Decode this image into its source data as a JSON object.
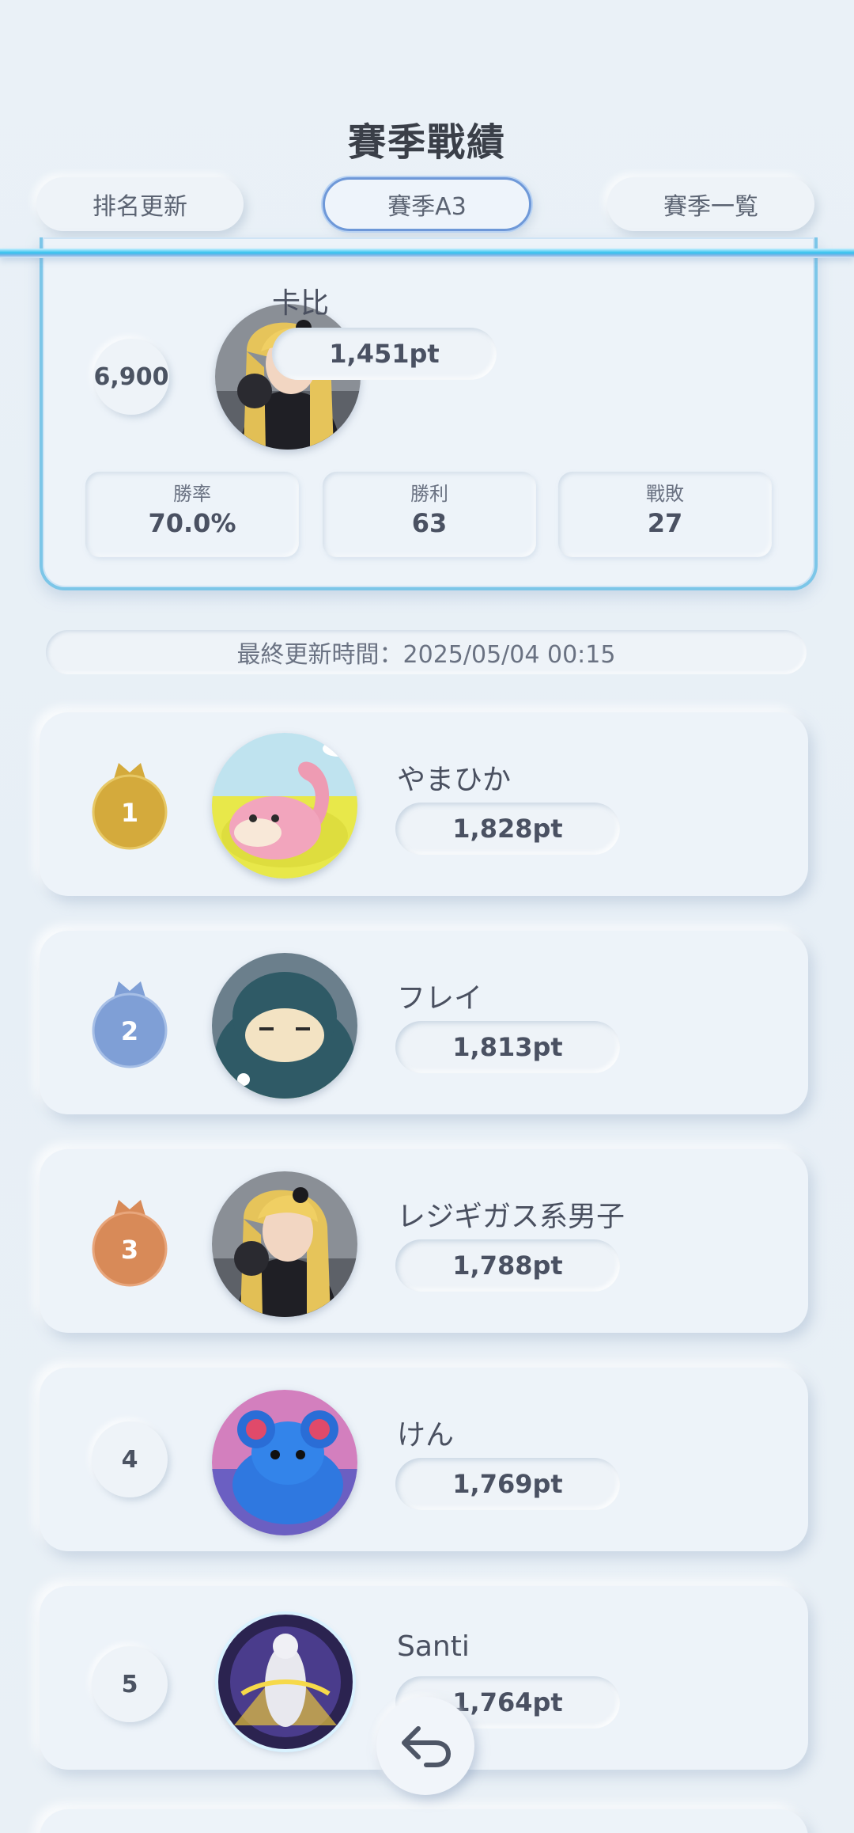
{
  "header": {
    "title": "賽季戰績",
    "tabs": [
      {
        "label": "排名更新",
        "active": false
      },
      {
        "label": "賽季A3",
        "active": true
      },
      {
        "label": "賽季一覧",
        "active": false
      }
    ]
  },
  "self": {
    "rank": "6,900",
    "name": "卡比",
    "points": "1,451pt",
    "stats": [
      {
        "label": "勝率",
        "value": "70.0%"
      },
      {
        "label": "勝利",
        "value": "63"
      },
      {
        "label": "戰敗",
        "value": "27"
      }
    ]
  },
  "last_updated": "最終更新時間：2025/05/04 00:15",
  "ranking": [
    {
      "rank": "1",
      "name": "やまひか",
      "points": "1,828pt",
      "medal_color": "#d4aa3c"
    },
    {
      "rank": "2",
      "name": "フレイ",
      "points": "1,813pt",
      "medal_color": "#7f9fd6"
    },
    {
      "rank": "3",
      "name": "レジギガス系男子",
      "points": "1,788pt",
      "medal_color": "#d88a58"
    },
    {
      "rank": "4",
      "name": "けん",
      "points": "1,769pt"
    },
    {
      "rank": "5",
      "name": "Santi",
      "points": "1,764pt"
    }
  ],
  "icons": {
    "back": "return-arrow-icon",
    "crown": "crown-icon"
  }
}
